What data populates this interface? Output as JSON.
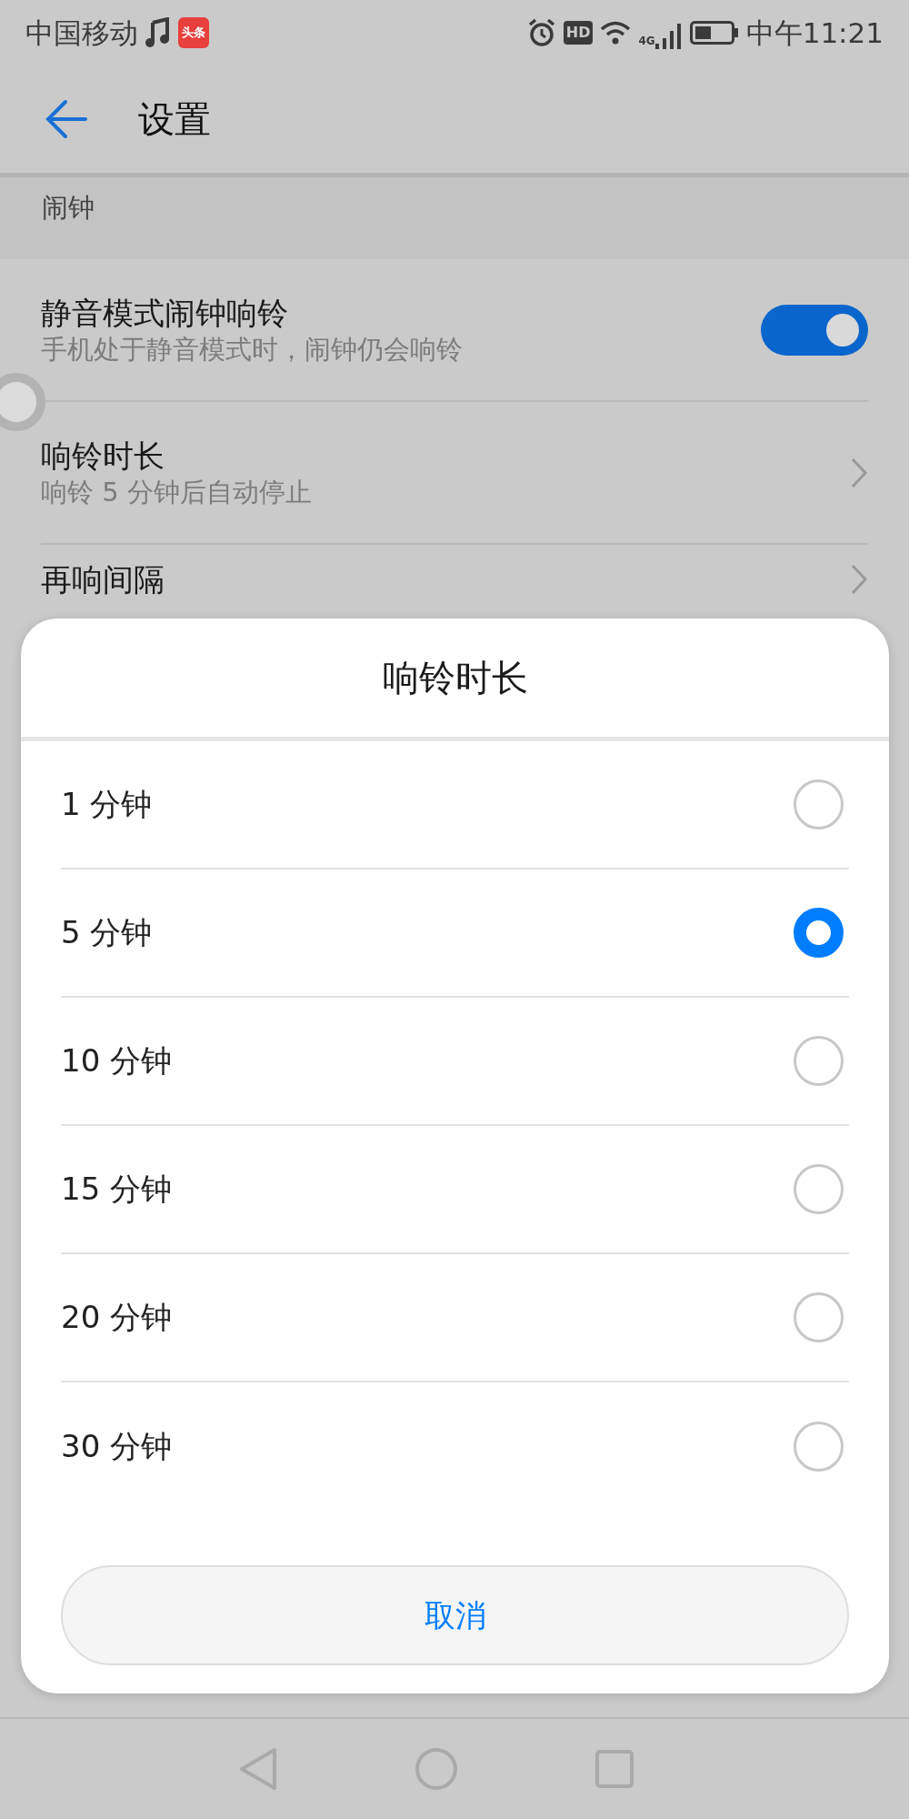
{
  "status_bar": {
    "carrier": "中国移动",
    "app_badge": "头条",
    "hd_label": "HD",
    "network": "4G",
    "time": "中午11:21"
  },
  "header": {
    "title": "设置"
  },
  "section": {
    "title": "闹钟"
  },
  "settings": [
    {
      "kind": "toggle",
      "title": "静音模式闹钟响铃",
      "subtitle": "手机处于静音模式时，闹钟仍会响铃",
      "on": true
    },
    {
      "kind": "link",
      "title": "响铃时长",
      "subtitle": "响铃 5 分钟后自动停止"
    },
    {
      "kind": "link",
      "title": "再响间隔"
    }
  ],
  "dialog": {
    "title": "响铃时长",
    "options": [
      {
        "label": "1 分钟",
        "selected": false
      },
      {
        "label": "5 分钟",
        "selected": true
      },
      {
        "label": "10 分钟",
        "selected": false
      },
      {
        "label": "15 分钟",
        "selected": false
      },
      {
        "label": "20 分钟",
        "selected": false
      },
      {
        "label": "30 分钟",
        "selected": false
      }
    ],
    "cancel": "取消"
  }
}
